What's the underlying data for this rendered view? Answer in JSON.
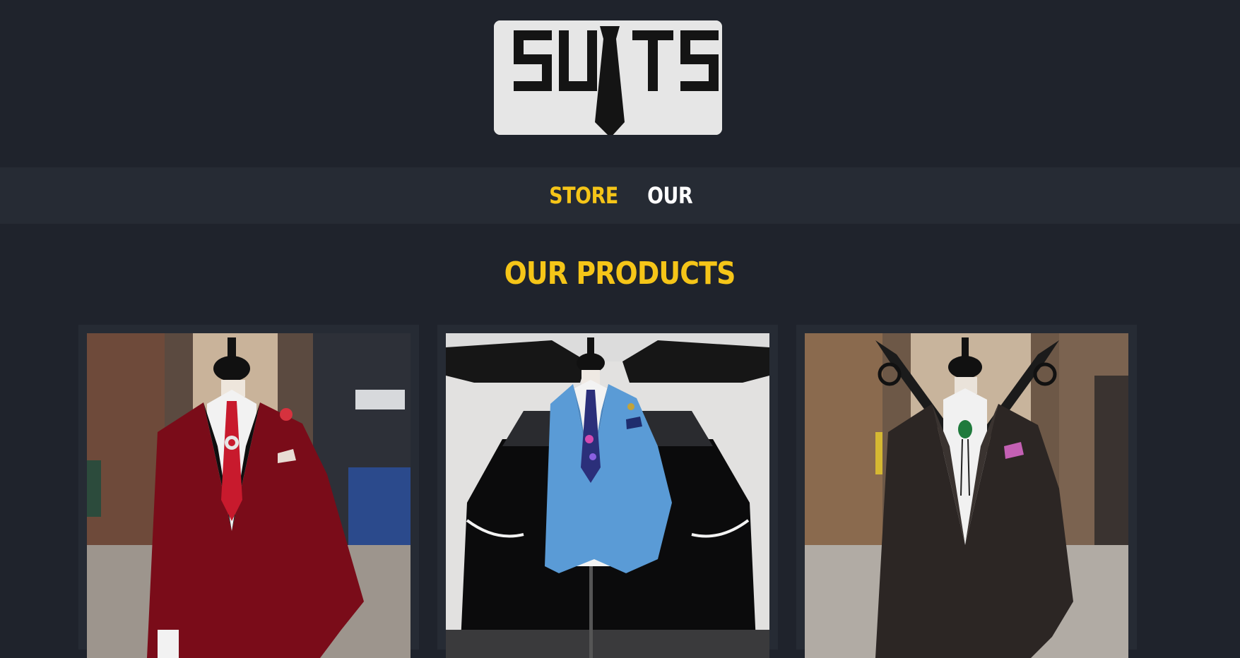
{
  "logo": {
    "text": "SUITS"
  },
  "nav": {
    "items": [
      {
        "label": "STORE",
        "active": true
      },
      {
        "label": "OUR",
        "active": false
      }
    ]
  },
  "main": {
    "title": "OUR PRODUCTS",
    "products": [
      {
        "image": "red-velvet-tuxedo-jacket"
      },
      {
        "image": "light-blue-suit-jacket"
      },
      {
        "image": "charcoal-suit-jacket"
      }
    ]
  },
  "colors": {
    "background": "#1f232c",
    "navbar": "#262b34",
    "accent": "#f5c518"
  }
}
